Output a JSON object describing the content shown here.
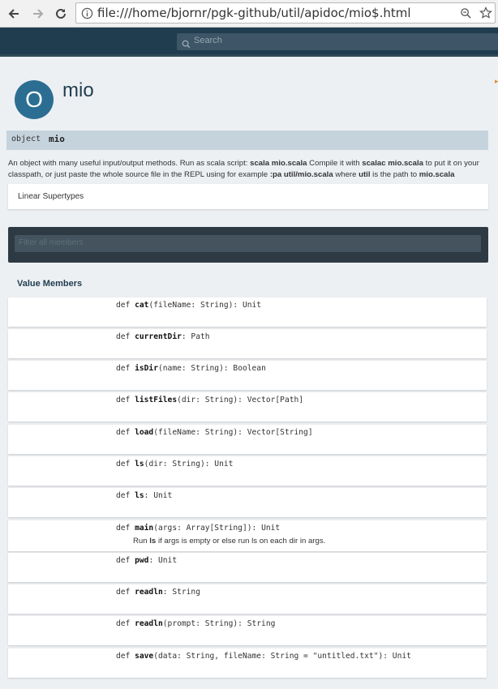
{
  "browser": {
    "url": "file:///home/bjornr/pgk-github/util/apidoc/mio$.html"
  },
  "header": {
    "search_placeholder": "Search"
  },
  "entity": {
    "badge": "O",
    "title": "mio",
    "kind": "object",
    "name": "mio"
  },
  "description": {
    "t1": "An object with many useful input/output methods. Run as scala script: ",
    "c1": "scala mio.scala",
    "t2": " Compile it with ",
    "c2": "scalac mio.scala",
    "t3": " to put it on your classpath, or just paste the whole source file in the REPL using for example ",
    "c3": ":pa util/mio.scala",
    "t4": " where ",
    "c4": "util",
    "t5": " is the path to ",
    "c5": "mio.scala"
  },
  "linear_supertypes": "Linear Supertypes",
  "filter_placeholder": "Filter all members",
  "value_members_heading": "Value Members",
  "members": [
    {
      "kw": "def",
      "name": "cat",
      "sig": "(fileName: String): Unit"
    },
    {
      "kw": "def",
      "name": "currentDir",
      "sig": ": Path"
    },
    {
      "kw": "def",
      "name": "isDir",
      "sig": "(name: String): Boolean"
    },
    {
      "kw": "def",
      "name": "listFiles",
      "sig": "(dir: String): Vector[Path]"
    },
    {
      "kw": "def",
      "name": "load",
      "sig": "(fileName: String): Vector[String]"
    },
    {
      "kw": "def",
      "name": "ls",
      "sig": "(dir: String): Unit"
    },
    {
      "kw": "def",
      "name": "ls",
      "sig": ": Unit"
    },
    {
      "kw": "def",
      "name": "main",
      "sig": "(args: Array[String]): Unit",
      "comment_pre": "Run ",
      "comment_bold": "ls",
      "comment_post": " if args is empty or else run ls on each dir in args."
    },
    {
      "kw": "def",
      "name": "pwd",
      "sig": ": Unit"
    },
    {
      "kw": "def",
      "name": "readln",
      "sig": ": String"
    },
    {
      "kw": "def",
      "name": "readln",
      "sig": "(prompt: String): String"
    },
    {
      "kw": "def",
      "name": "save",
      "sig": "(data: String, fileName: String = \"untitled.txt\"): Unit"
    }
  ]
}
